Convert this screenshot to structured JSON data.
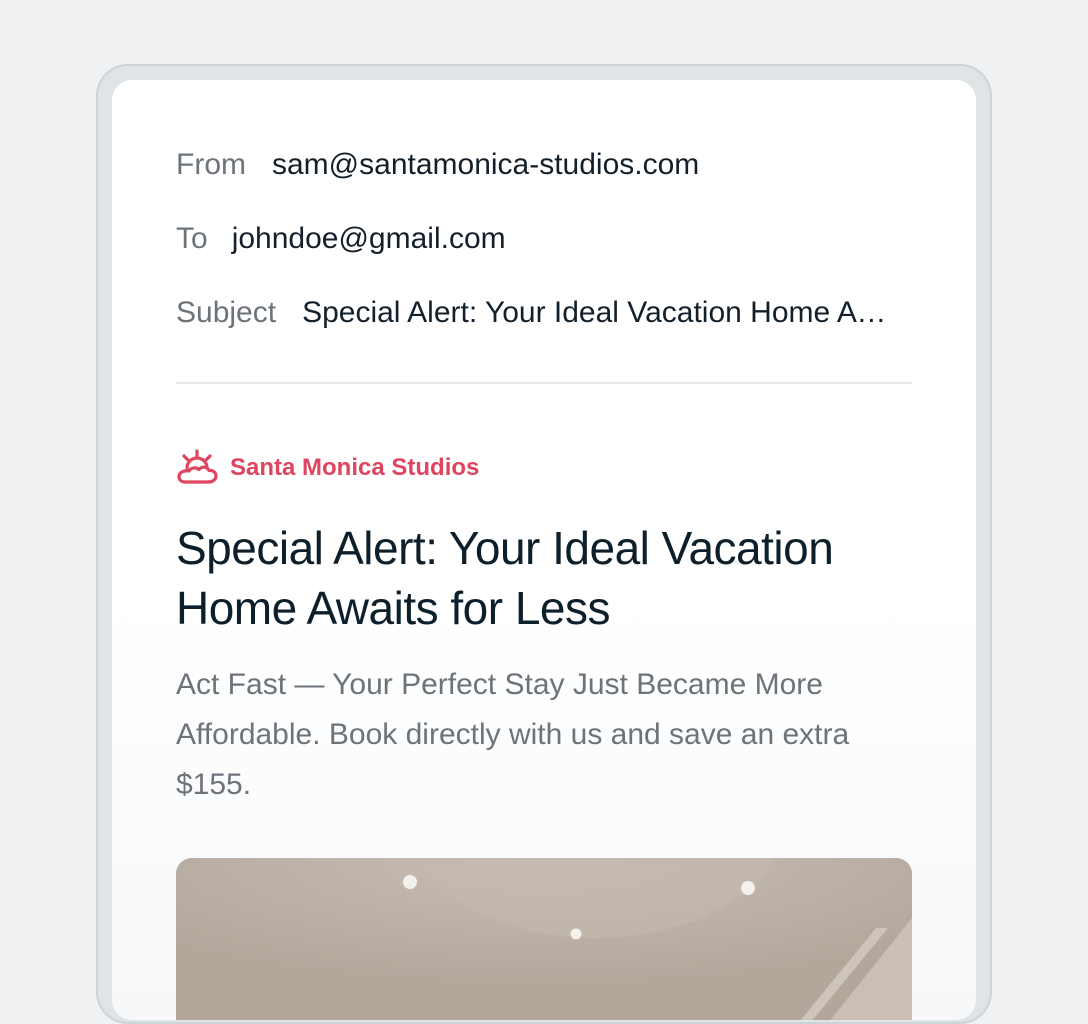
{
  "email": {
    "from_label": "From",
    "from_value": "sam@santamonica-studios.com",
    "to_label": "To",
    "to_value": "johndoe@gmail.com",
    "subject_label": "Subject",
    "subject_value": "Special Alert: Your Ideal Vacation Home Awaits for Less"
  },
  "content": {
    "brand_icon": "sun-over-cloud-icon",
    "brand_name": "Santa Monica Studios",
    "headline": "Special Alert: Your Ideal Vacation Home Awaits for Less",
    "body_text": "Act Fast — Your Perfect Stay Just Became More Affordable. Book directly with us and save an extra $155.",
    "hero_image": "room-interior-photo"
  },
  "colors": {
    "page_background": "#eff1f3",
    "brand_accent": "#e0455f",
    "headline_text": "#0d1f2b",
    "muted_text": "#6c737a"
  }
}
